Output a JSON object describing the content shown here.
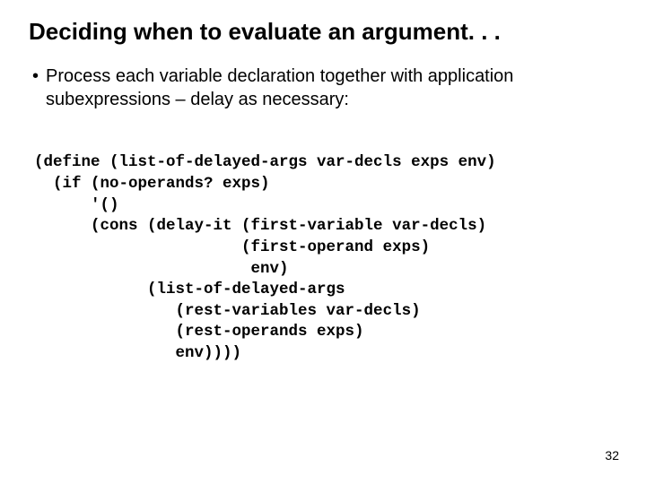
{
  "title": "Deciding when to evaluate an argument. . .",
  "bullet": {
    "marker": "•",
    "text": "Process each variable declaration together with application subexpressions – delay as necessary:"
  },
  "code": {
    "l1": "(define (list-of-delayed-args var-decls exps env)",
    "l2": "  (if (no-operands? exps)",
    "l3": "      '()",
    "l4": "      (cons (delay-it (first-variable var-decls)",
    "l5": "                      (first-operand exps)",
    "l6": "                       env)",
    "l7": "            (list-of-delayed-args",
    "l8": "               (rest-variables var-decls)",
    "l9": "               (rest-operands exps)",
    "l10": "               env))))"
  },
  "pageNumber": "32"
}
